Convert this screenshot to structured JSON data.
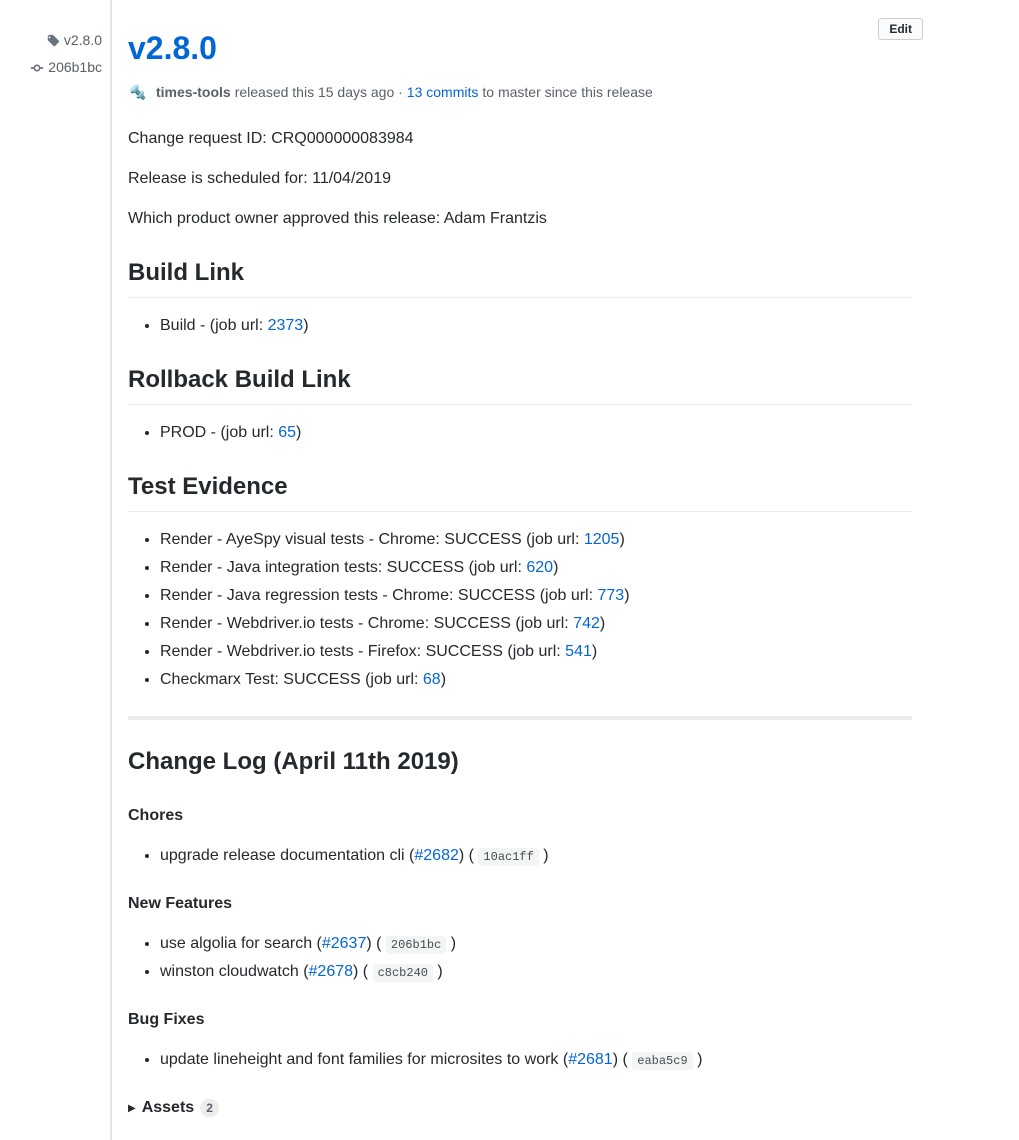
{
  "sidebar": {
    "tag": "v2.8.0",
    "commit": "206b1bc"
  },
  "header": {
    "edit_label": "Edit",
    "title": "v2.8.0"
  },
  "meta": {
    "avatar_emoji": "🔩",
    "author": "times-tools",
    "released_text": " released this 15 days ago · ",
    "commits_link": "13 commits",
    "branch_text": " to master since this release"
  },
  "description": {
    "line1": "Change request ID: CRQ000000083984",
    "line2": "Release is scheduled for: 11/04/2019",
    "line3": "Which product owner approved this release: Adam Frantzis"
  },
  "sections": {
    "build_link": {
      "title": "Build Link",
      "items": [
        {
          "prefix": "Build - (job url: ",
          "link": "2373",
          "suffix": ")"
        }
      ]
    },
    "rollback": {
      "title": "Rollback Build Link",
      "items": [
        {
          "prefix": "PROD - (job url: ",
          "link": "65",
          "suffix": ")"
        }
      ]
    },
    "test_evidence": {
      "title": "Test Evidence",
      "items": [
        {
          "prefix": "Render - AyeSpy visual tests - Chrome: SUCCESS (job url: ",
          "link": "1205",
          "suffix": ")"
        },
        {
          "prefix": "Render - Java integration tests: SUCCESS (job url: ",
          "link": "620",
          "suffix": ")"
        },
        {
          "prefix": "Render - Java regression tests - Chrome: SUCCESS (job url: ",
          "link": "773",
          "suffix": ")"
        },
        {
          "prefix": "Render - Webdriver.io tests - Chrome: SUCCESS (job url: ",
          "link": "742",
          "suffix": ")"
        },
        {
          "prefix": "Render - Webdriver.io tests - Firefox: SUCCESS (job url: ",
          "link": "541",
          "suffix": ")"
        },
        {
          "prefix": "Checkmarx Test: SUCCESS (job url: ",
          "link": "68",
          "suffix": ")"
        }
      ]
    }
  },
  "changelog": {
    "title": "Change Log (April 11th 2019)",
    "groups": [
      {
        "heading": "Chores",
        "items": [
          {
            "text": "upgrade release documentation cli (",
            "issue": "#2682",
            "mid": ") ( ",
            "sha": "10ac1ff",
            "end": " )"
          }
        ]
      },
      {
        "heading": "New Features",
        "items": [
          {
            "text": "use algolia for search (",
            "issue": "#2637",
            "mid": ") ( ",
            "sha": "206b1bc",
            "end": " )"
          },
          {
            "text": "winston cloudwatch (",
            "issue": "#2678",
            "mid": ") ( ",
            "sha": "c8cb240",
            "end": " )"
          }
        ]
      },
      {
        "heading": "Bug Fixes",
        "items": [
          {
            "text": "update lineheight and font families for microsites to work (",
            "issue": "#2681",
            "mid": ") ( ",
            "sha": "eaba5c9",
            "end": " )"
          }
        ]
      }
    ]
  },
  "assets": {
    "label": "Assets",
    "count": "2"
  }
}
